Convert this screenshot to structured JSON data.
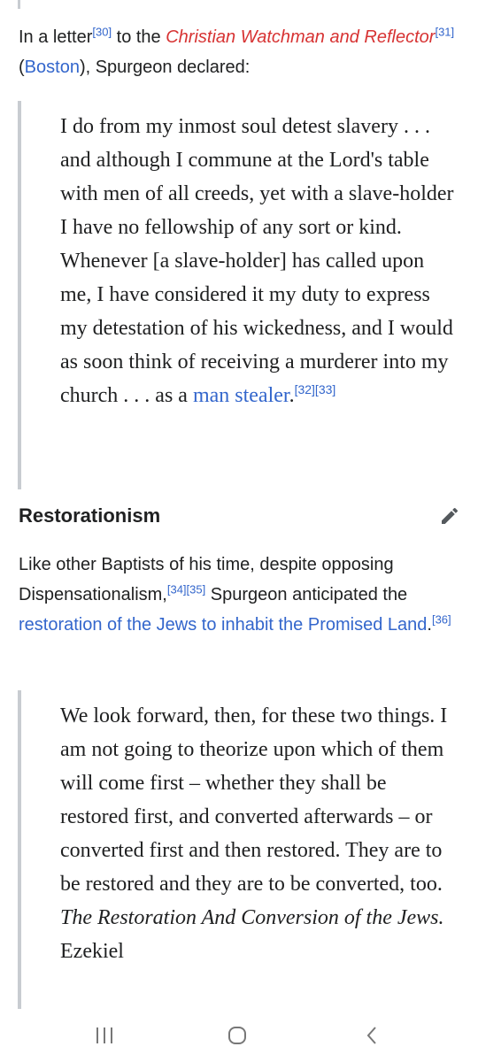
{
  "intro": {
    "t1": "In a letter",
    "ref30": "[30]",
    "t2": " to the ",
    "publication": "Christian Watchman and Reflector",
    "ref31": "[31]",
    "t3": " (",
    "city_link": "Boston",
    "t4": "), Spurgeon declared:"
  },
  "quote1": {
    "text": "I do from my inmost soul detest slavery . . . and although I commune at the Lord's table with men of all creeds, yet with a slave-holder I have no fellowship of any sort or kind. Whenever [a slave-holder] has called upon me, I have considered it my duty to express my detestation of his wickedness, and I would as soon think of receiving a murderer into my church . . . as a ",
    "link": "man stealer",
    "end": ".",
    "refs": "[32][33]"
  },
  "section": {
    "title": "Restorationism",
    "edit_icon": "pencil-icon"
  },
  "para2": {
    "t1": "Like other Baptists of his time, despite opposing Dispensationalism,",
    "refs1": "[34][35]",
    "t2": " Spurgeon anticipated the ",
    "link": "restoration of the Jews to inhabit the Promised Land",
    "t3": ".",
    "ref36": "[36]"
  },
  "quote2": {
    "text": "We look forward, then, for these two things. I am not going to theorize upon which of them will come first – whether they shall be restored first, and converted afterwards – or converted first and then restored. They are to be restored and they are to be converted, too. ",
    "italic": "The Restoration And Conversion of the Jews.",
    "tail": " Ezekiel"
  },
  "nav": {
    "recent_icon": "recent-apps-icon",
    "home_icon": "home-icon",
    "back_icon": "back-icon"
  },
  "colors": {
    "link": "#3366cc",
    "redlink": "#d73333",
    "text": "#202122",
    "quote_border": "#c8ccd1"
  }
}
